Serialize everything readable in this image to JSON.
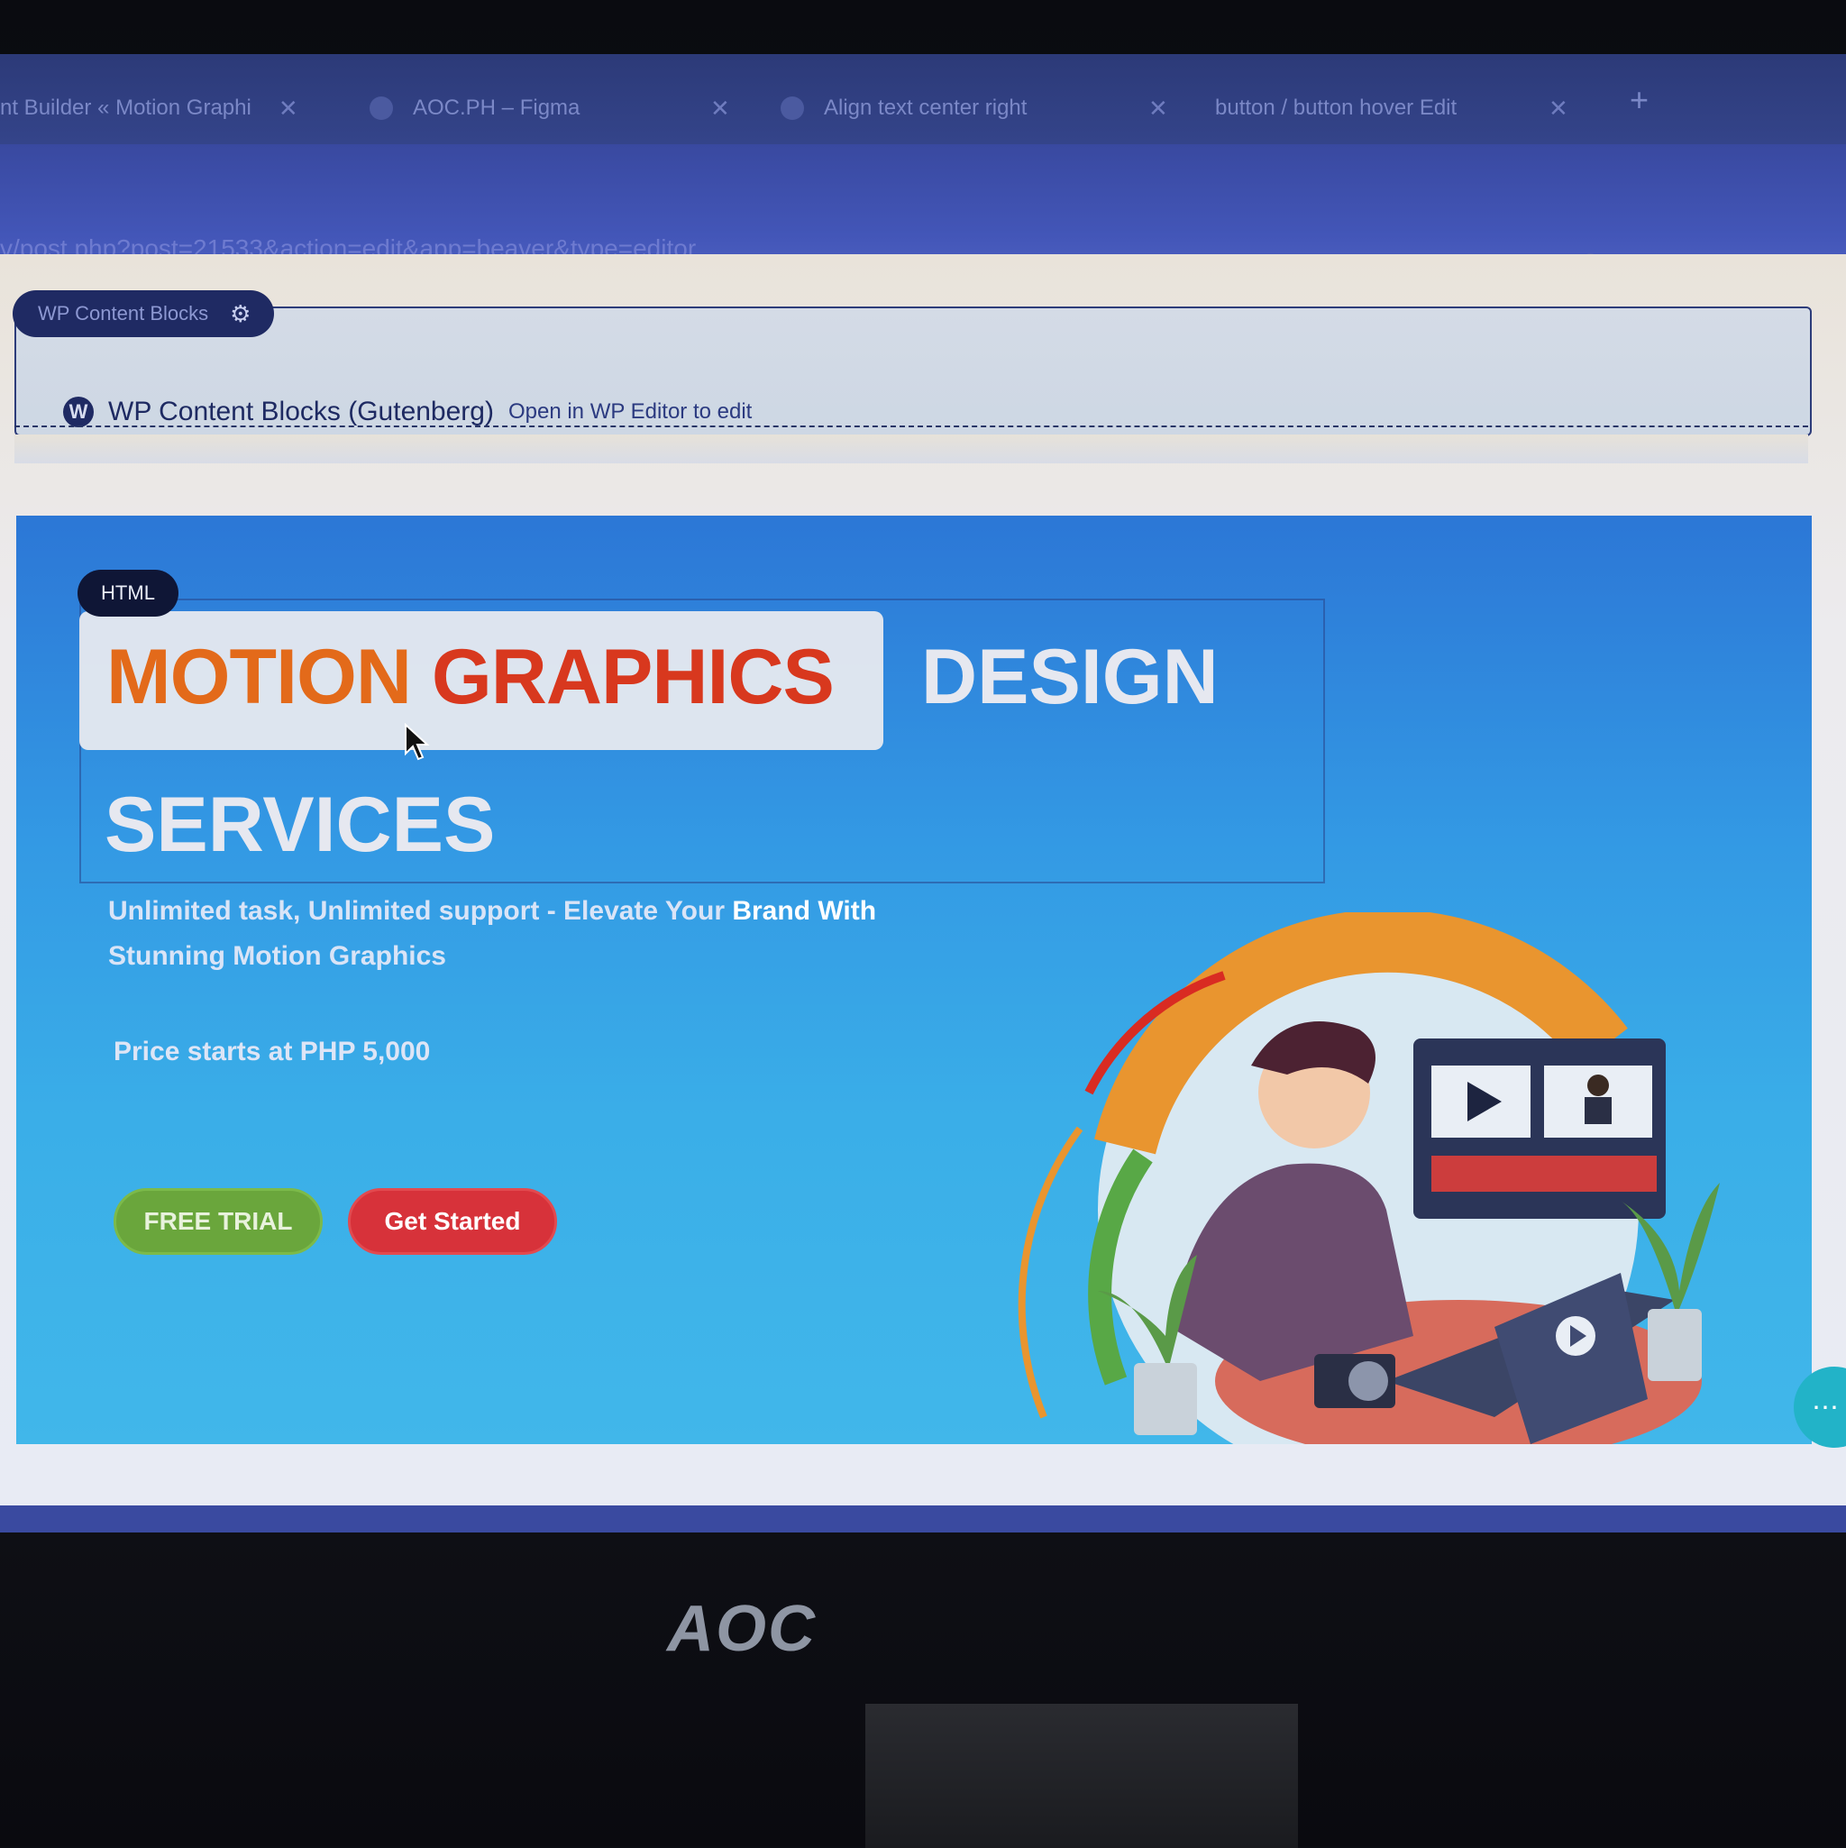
{
  "browser": {
    "tabs": [
      {
        "label": "nt Builder « Motion Graphi"
      },
      {
        "label": "AOC.PH – Figma"
      },
      {
        "label": "Align text center right"
      },
      {
        "label": "button / button hover Edit"
      }
    ],
    "url": "v/post.php?post=21533&action=edit&app=beaver&type=editor",
    "tab_close": "✕",
    "new_tab": "+"
  },
  "wp_block": {
    "tag": "WP Content Blocks",
    "title": "WP Content Blocks (Gutenberg)",
    "edit_link": "Open in WP Editor to edit"
  },
  "hero": {
    "html_tag": "HTML",
    "headline_word1": "MOTION",
    "headline_word2": "GRAPHICS",
    "headline_word3": "DESIGN",
    "headline_line2": "SERVICES",
    "subtext_a": "Unlimited task, Unlimited support - Elevate Your ",
    "subtext_b": "Brand With",
    "subtext_c": "Stunning Motion Graphics",
    "price": "Price starts at PHP 5,000",
    "btn_trial": "FREE TRIAL",
    "btn_start": "Get Started"
  },
  "monitor": {
    "brand": "AOC"
  },
  "colors": {
    "hero_blue": "#3399e4",
    "accent_orange": "#e36a1a",
    "accent_red": "#d8381e",
    "trial_green": "#6aa63c",
    "start_red": "#d7323a",
    "wp_navy": "#1f2a63"
  },
  "icons": [
    "gear-icon",
    "wordpress-icon",
    "cursor-icon",
    "play-icon",
    "chat-icon",
    "search-icon",
    "star-icon",
    "extension-icon"
  ]
}
